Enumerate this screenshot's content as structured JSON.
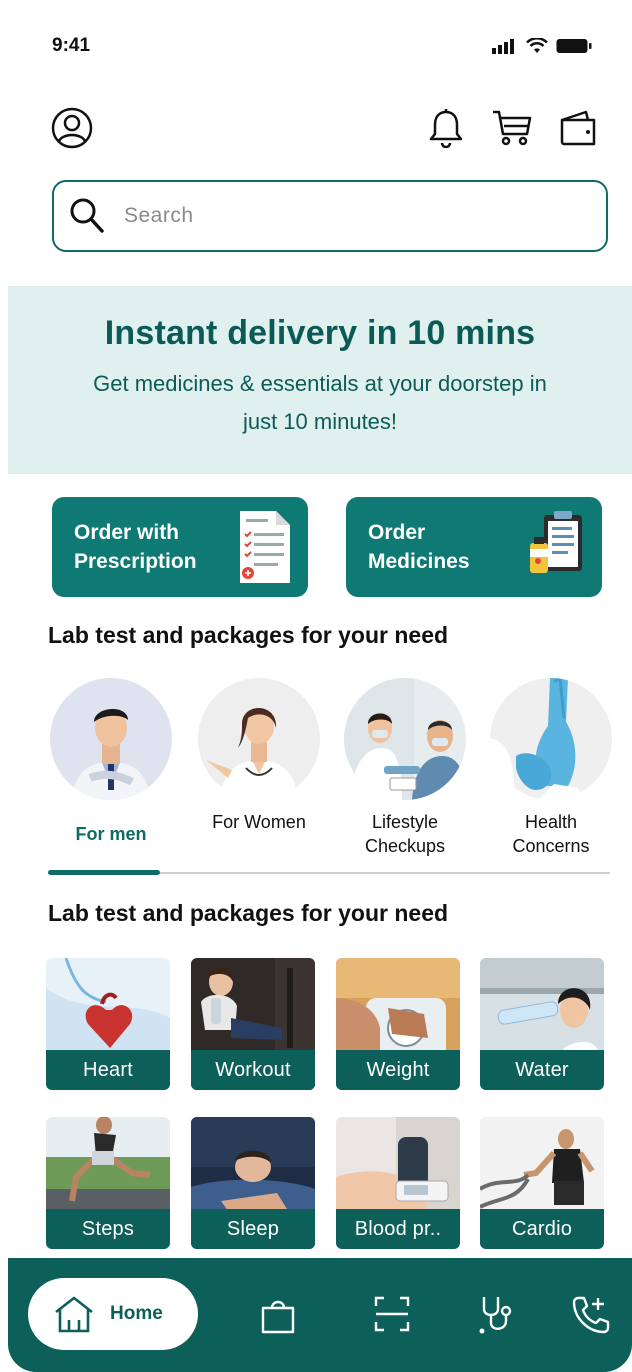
{
  "status_bar": {
    "time": "9:41"
  },
  "search": {
    "placeholder": "Search"
  },
  "banner": {
    "title": "Instant delivery in 10 mins",
    "subtitle": "Get medicines & essentials at your doorstep in just 10 minutes!"
  },
  "order_buttons": [
    {
      "label": "Order with\nPrescription",
      "icon": "prescription-icon"
    },
    {
      "label": "Order\nMedicines",
      "icon": "medicines-icon"
    }
  ],
  "sections": {
    "lab_tests_title_1": "Lab test and packages for your need",
    "lab_tests_title_2": "Lab test and packages for your need"
  },
  "categories": [
    {
      "label": "For men",
      "active": true
    },
    {
      "label": "For Women",
      "active": false
    },
    {
      "label": "Lifestyle\nCheckups",
      "active": false
    },
    {
      "label": "Health\nConcerns",
      "active": false
    }
  ],
  "tiles": [
    {
      "label": "Heart"
    },
    {
      "label": "Workout"
    },
    {
      "label": "Weight"
    },
    {
      "label": "Water"
    },
    {
      "label": "Steps"
    },
    {
      "label": "Sleep"
    },
    {
      "label": "Blood pr.."
    },
    {
      "label": "Cardio"
    }
  ],
  "bottom_nav": {
    "home_label": "Home",
    "items": [
      "home-icon",
      "bag-icon",
      "scan-icon",
      "stethoscope-icon",
      "phone-plus-icon"
    ]
  },
  "colors": {
    "primary": "#0f7a73",
    "primary_dark": "#0d5f59",
    "banner_bg": "#dff0ef",
    "banner_text": "#0b5a55"
  }
}
